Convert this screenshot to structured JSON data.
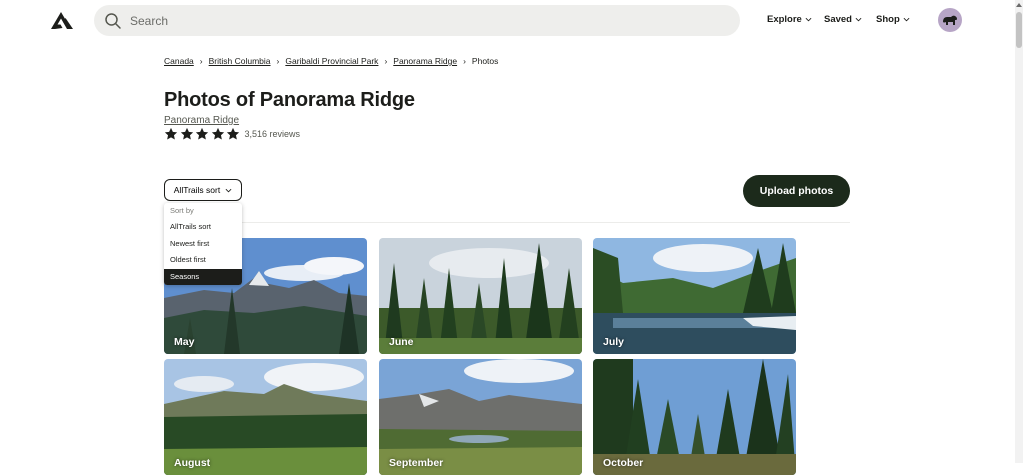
{
  "header": {
    "search_placeholder": "Search",
    "nav": [
      {
        "label": "Explore"
      },
      {
        "label": "Saved"
      },
      {
        "label": "Shop"
      }
    ]
  },
  "breadcrumb": {
    "items": [
      "Canada",
      "British Columbia",
      "Garibaldi Provincial Park",
      "Panorama Ridge"
    ],
    "current": "Photos",
    "separator": "›"
  },
  "page": {
    "title": "Photos of Panorama Ridge",
    "trail_link": "Panorama Ridge",
    "rating": 5,
    "reviews": "3,516 reviews"
  },
  "sort": {
    "button_label": "AllTrails sort",
    "menu_heading": "Sort by",
    "options": [
      "AllTrails sort",
      "Newest first",
      "Oldest first",
      "Seasons"
    ],
    "selected": "Seasons"
  },
  "upload_label": "Upload photos",
  "photos": [
    {
      "label": "May"
    },
    {
      "label": "June"
    },
    {
      "label": "July"
    },
    {
      "label": "August"
    },
    {
      "label": "September"
    },
    {
      "label": "October"
    }
  ],
  "colors": {
    "primary_dark": "#1c2a1b",
    "text": "#1c1d1a",
    "search_bg": "#eeeeec",
    "avatar_bg": "#b7a5c6"
  },
  "icons": [
    "alltrails-logo-icon",
    "search-icon",
    "chevron-down-icon",
    "bear-avatar-icon",
    "star-icon"
  ]
}
